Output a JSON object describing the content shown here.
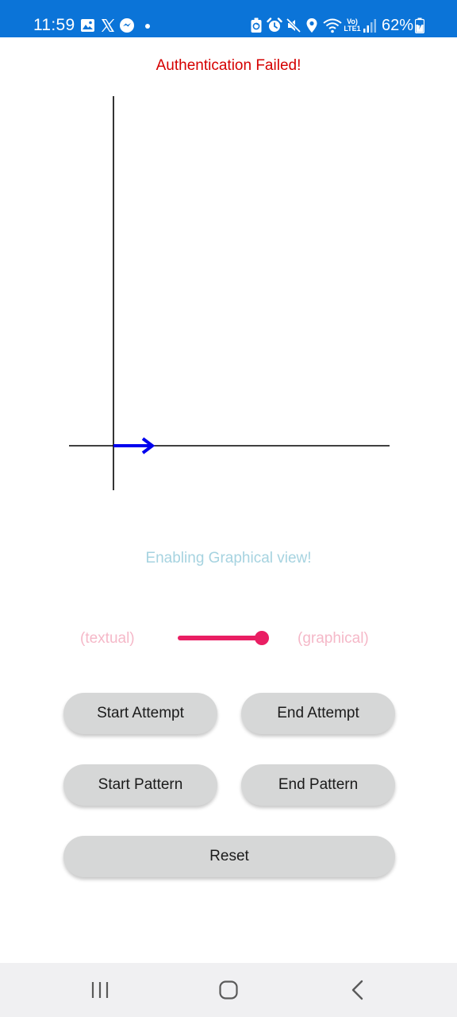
{
  "status_bar": {
    "time": "11:59",
    "network_label": "Vo) LTE1",
    "battery_percent": "62%",
    "background_color": "#0b74d8",
    "left_icons": [
      "gallery-icon",
      "x-app-icon",
      "messenger-icon",
      "dot-icon"
    ],
    "right_icons": [
      "battery-saver-icon",
      "alarm-icon",
      "mute-icon",
      "location-icon",
      "wifi-icon",
      "signal-icon",
      "battery-icon"
    ]
  },
  "main": {
    "auth_message": "Authentication Failed!",
    "auth_message_color": "#d50000",
    "graph": {
      "axis_color": "#000000",
      "vector_color": "#0000ee"
    },
    "mode_message": "Enabling Graphical view!",
    "view_toggle": {
      "left_label": "(textual)",
      "right_label": "(graphical)",
      "checked": true,
      "accent_color": "#e91e63"
    },
    "buttons": {
      "start_attempt": "Start Attempt",
      "end_attempt": "End Attempt",
      "start_pattern": "Start Pattern",
      "end_pattern": "End Pattern",
      "reset": "Reset"
    }
  },
  "nav_bar": {
    "icons": [
      "recents-icon",
      "home-icon",
      "back-icon"
    ]
  }
}
